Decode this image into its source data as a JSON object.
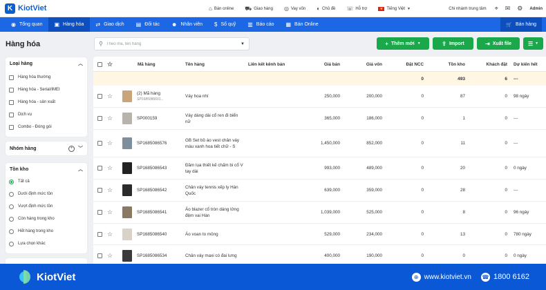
{
  "app": {
    "logo_text": "KiotViet"
  },
  "topbar": {
    "links": [
      {
        "label": "Bán online",
        "icon": "store-icon"
      },
      {
        "label": "Giao hàng",
        "icon": "delivery-icon"
      },
      {
        "label": "Vay vốn",
        "icon": "loan-icon"
      },
      {
        "label": "Chủ đề",
        "icon": "theme-icon"
      },
      {
        "label": "Hỗ trợ",
        "icon": "support-icon"
      },
      {
        "label": "Tiếng Việt",
        "icon": "vn-flag-icon"
      }
    ],
    "branch": "Chi nhánh trung tâm",
    "admin": "Admin"
  },
  "nav": {
    "items": [
      {
        "label": "Tổng quan"
      },
      {
        "label": "Hàng hóa"
      },
      {
        "label": "Giao dịch"
      },
      {
        "label": "Đối tác"
      },
      {
        "label": "Nhân viên"
      },
      {
        "label": "Sổ quỹ"
      },
      {
        "label": "Báo cáo"
      },
      {
        "label": "Bán Online"
      }
    ],
    "sell_label": "Bán hàng"
  },
  "page": {
    "title": "Hàng hóa"
  },
  "search": {
    "placeholder": "Theo mã, tên hàng"
  },
  "actions": {
    "add": "Thêm mới",
    "import": "Import",
    "export": "Xuất file"
  },
  "filters": {
    "type": {
      "title": "Loại hàng",
      "options": [
        "Hàng hóa thường",
        "Hàng hóa - Serial/IMEI",
        "Hàng hóa - sản xuất",
        "Dịch vụ",
        "Combo - Đóng gói"
      ]
    },
    "group": {
      "title": "Nhóm hàng"
    },
    "stock": {
      "title": "Tồn kho",
      "options": [
        "Tất cả",
        "Dưới định mức tồn",
        "Vượt định mức tồn",
        "Còn hàng trong kho",
        "Hết hàng trong kho",
        "Lựa chọn khác"
      ],
      "selected": "Tất cả"
    }
  },
  "table": {
    "headers": {
      "code": "Mã hàng",
      "name": "Tên hàng",
      "channel": "Liên kết kênh bán",
      "price": "Giá bán",
      "cost": "Giá vốn",
      "ncc": "Đặt NCC",
      "stock": "Tồn kho",
      "customer": "Khách đặt",
      "forecast": "Dự kiến hết"
    },
    "summary": {
      "ncc": "0",
      "stock": "493",
      "customer": "6",
      "forecast": "---"
    },
    "rows": [
      {
        "code": "(2) Mã hàng",
        "subcode": "SP1685086601...",
        "name": "Váy hoa nhí",
        "price": "250,000",
        "cost": "200,000",
        "ncc": "0",
        "stock": "87",
        "customer": "0",
        "forecast": "98 ngày",
        "thumb_color": "#c9a57a"
      },
      {
        "code": "SP000159",
        "name": "Váy dáng dài cổ ren đi biển nữ",
        "price": "365,000",
        "cost": "186,000",
        "ncc": "0",
        "stock": "1",
        "customer": "0",
        "forecast": "---",
        "thumb_color": "#b9b3ad"
      },
      {
        "code": "SP1685086576",
        "name": "GB Set bồ áo vest chân váy màu xanh hoa tiết chữ - S",
        "price": "1,450,000",
        "cost": "852,000",
        "ncc": "0",
        "stock": "11",
        "customer": "0",
        "forecast": "---",
        "thumb_color": "#7e8e9a"
      },
      {
        "code": "SP1685086543",
        "name": "Đầm lụa thiết kế chấm bi cổ V tay dài",
        "price": "993,000",
        "cost": "489,000",
        "ncc": "0",
        "stock": "20",
        "customer": "0",
        "forecast": "0 ngày",
        "thumb_color": "#222222"
      },
      {
        "code": "SP1685086542",
        "name": "Chân váy tennis xếp ly Hàn Quốc",
        "price": "639,000",
        "cost": "359,000",
        "ncc": "0",
        "stock": "28",
        "customer": "0",
        "forecast": "---",
        "thumb_color": "#2b2b2b"
      },
      {
        "code": "SP1685086541",
        "name": "Áo blazer cổ tròn dáng lửng đệm vai Hàn",
        "price": "1,039,000",
        "cost": "525,000",
        "ncc": "0",
        "stock": "8",
        "customer": "0",
        "forecast": "96 ngày",
        "thumb_color": "#8a7a65"
      },
      {
        "code": "SP1685086540",
        "name": "Áo voan to mỏng",
        "price": "529,000",
        "cost": "234,000",
        "ncc": "0",
        "stock": "13",
        "customer": "0",
        "forecast": "780 ngày",
        "thumb_color": "#d8d2c8"
      },
      {
        "code": "SP1685086534",
        "name": "Chân váy maxi có đai lưng",
        "price": "400,000",
        "cost": "190,000",
        "ncc": "0",
        "stock": "0",
        "customer": "0",
        "forecast": "0 ngày",
        "thumb_color": "#3a3a3a"
      }
    ]
  },
  "footer": {
    "brand": "KiotViet",
    "website": "www.kiotviet.vn",
    "hotline": "1800 6162"
  }
}
